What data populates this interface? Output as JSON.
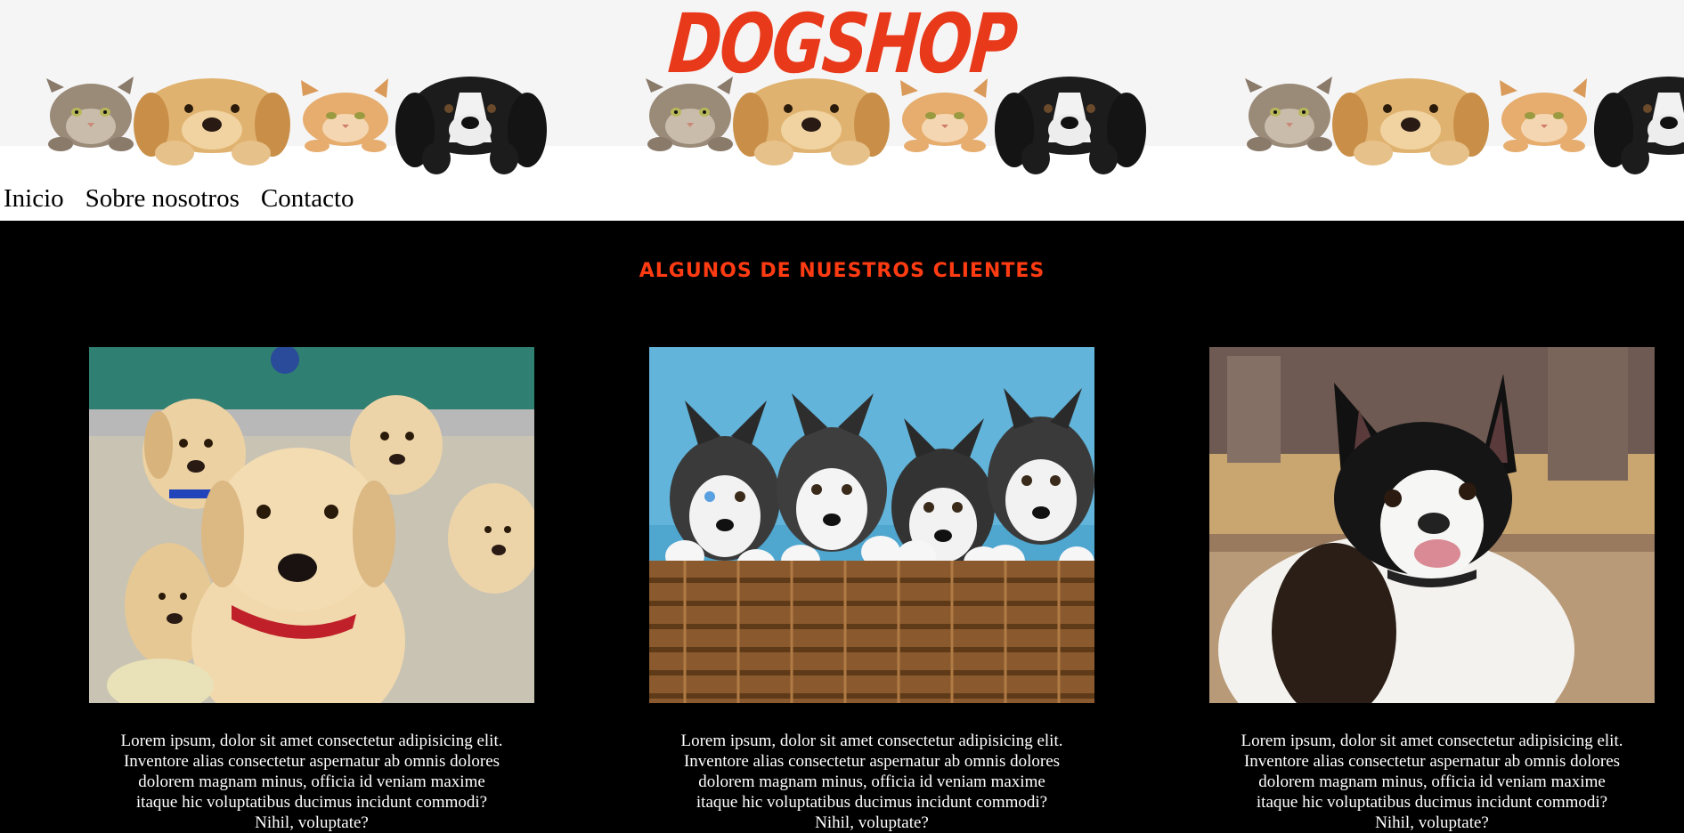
{
  "site": {
    "logo": "DOGSHOP"
  },
  "nav": {
    "items": [
      "Inicio",
      "Sobre nosotros",
      "Contacto"
    ]
  },
  "section": {
    "title": "ALGUNOS DE NUESTROS CLIENTES"
  },
  "cards": [
    {
      "image": "labrador-puppies-photo",
      "text": "Lorem ipsum, dolor sit amet consectetur adipisicing elit. Inventore alias consectetur aspernatur ab omnis dolores dolorem magnam minus, officia id veniam maxime itaque hic voluptatibus ducimus incidunt commodi? Nihil, voluptate?"
    },
    {
      "image": "husky-puppies-basket-photo",
      "text": "Lorem ipsum, dolor sit amet consectetur adipisicing elit. Inventore alias consectetur aspernatur ab omnis dolores dolorem magnam minus, officia id veniam maxime itaque hic voluptatibus ducimus incidunt commodi? Nihil, voluptate?"
    },
    {
      "image": "french-bulldog-photo",
      "text": "Lorem ipsum, dolor sit amet consectetur adipisicing elit. Inventore alias consectetur aspernatur ab omnis dolores dolorem magnam minus, officia id veniam maxime itaque hic voluptatibus ducimus incidunt commodi? Nihil, voluptate?"
    }
  ],
  "colors": {
    "accent": "#e8391a",
    "title": "#ff3b12",
    "background": "#000000",
    "header_band": "#f5f5f5"
  }
}
